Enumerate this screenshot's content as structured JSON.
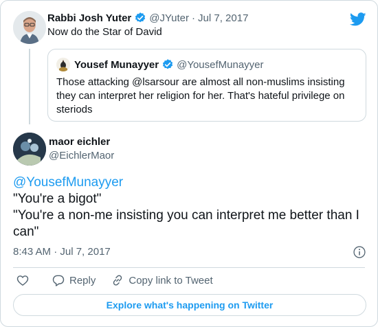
{
  "colors": {
    "accent": "#1d9bf0",
    "text": "#0f1419",
    "muted": "#536471",
    "border": "#cfd9de"
  },
  "parent_tweet": {
    "author_name": "Rabbi Josh Yuter",
    "handle": "@JYuter",
    "separator": "·",
    "date": "Jul 7, 2017",
    "text": "Now do the Star of David",
    "avatar_icon": "user-avatar-photo"
  },
  "quoted_tweet": {
    "author_name": "Yousef Munayyer",
    "handle": "@YousefMunayyer",
    "text": "Those attacking @lsarsour are almost all non-muslims insisting they can interpret her religion for her. That's hateful privilege on steriods",
    "avatar_icon": "user-avatar-photo"
  },
  "main_tweet": {
    "author_name": "maor eichler",
    "handle": "@EichlerMaor",
    "mention": "@YousefMunayyer",
    "line1": "\"You're a bigot\"",
    "line2": "\"You're a non-me insisting you can interpret me better than I can\"",
    "timestamp": "8:43 AM · Jul 7, 2017"
  },
  "actions": {
    "like_icon": "heart-icon",
    "reply_label": "Reply",
    "reply_icon": "speech-bubble-icon",
    "copy_label": "Copy link to Tweet",
    "copy_icon": "link-icon"
  },
  "footer": {
    "explore_label": "Explore what's happening on Twitter"
  }
}
